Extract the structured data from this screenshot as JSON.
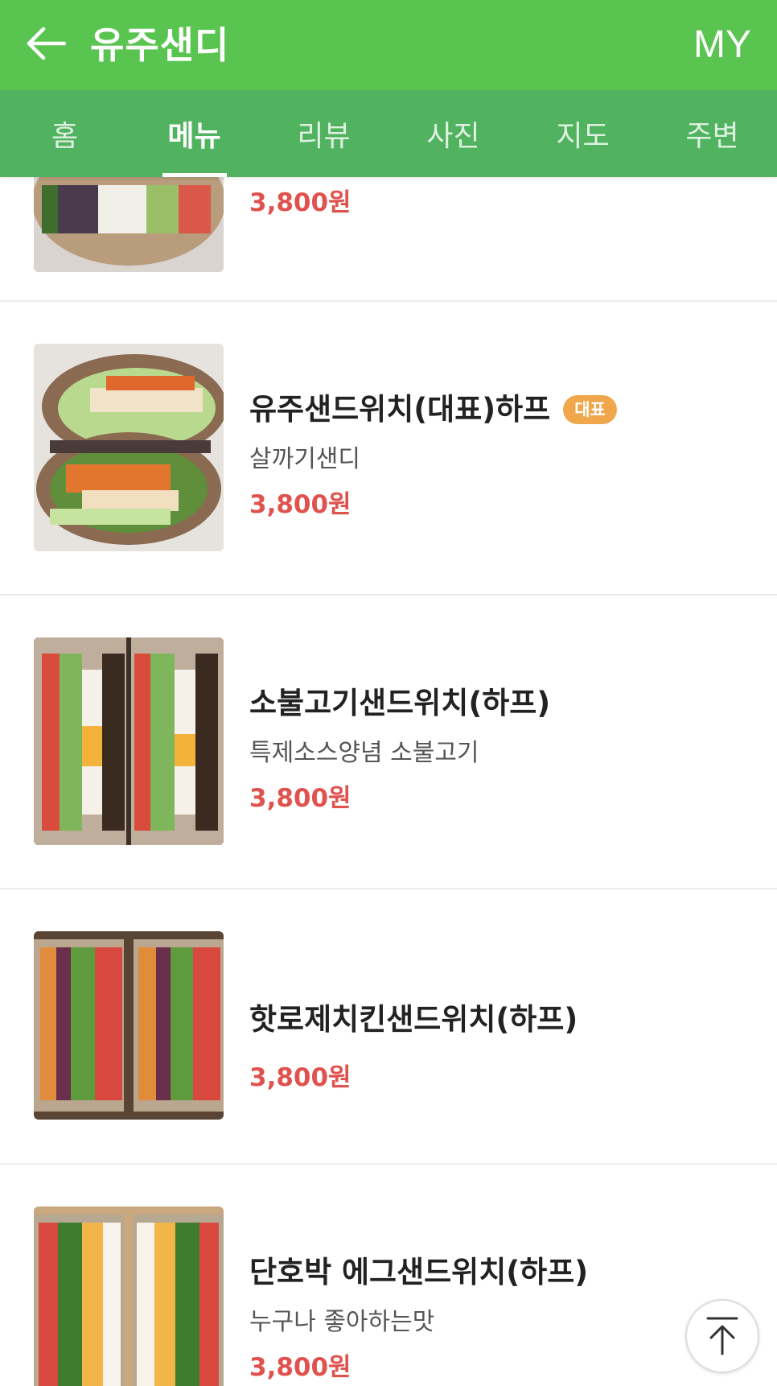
{
  "header": {
    "title": "유주샌디",
    "my_label": "MY",
    "back_icon": "back-arrow-icon",
    "background": "#5ac451"
  },
  "tabs": [
    {
      "label": "홈",
      "active": false
    },
    {
      "label": "메뉴",
      "active": true
    },
    {
      "label": "리뷰",
      "active": false
    },
    {
      "label": "사진",
      "active": false
    },
    {
      "label": "지도",
      "active": false
    },
    {
      "label": "주변",
      "active": false
    }
  ],
  "menu_items": [
    {
      "name": "",
      "description": "",
      "price": "3,800원",
      "badge": ""
    },
    {
      "name": "유주샌드위치(대표)하프",
      "description": "살까기샌디",
      "price": "3,800원",
      "badge": "대표"
    },
    {
      "name": "소불고기샌드위치(하프)",
      "description": "특제소스양념 소불고기",
      "price": "3,800원",
      "badge": ""
    },
    {
      "name": "핫로제치킨샌드위치(하프)",
      "description": "",
      "price": "3,800원",
      "badge": ""
    },
    {
      "name": "단호박 에그샌드위치(하프)",
      "description": "누구나 좋아하는맛",
      "price": "3,800원",
      "badge": ""
    }
  ],
  "colors": {
    "accent_green": "#5ac451",
    "tab_green": "#51b35f",
    "price_red": "#e0524e",
    "badge_orange": "#f0a64a"
  },
  "fab_icon": "scroll-to-top-icon"
}
